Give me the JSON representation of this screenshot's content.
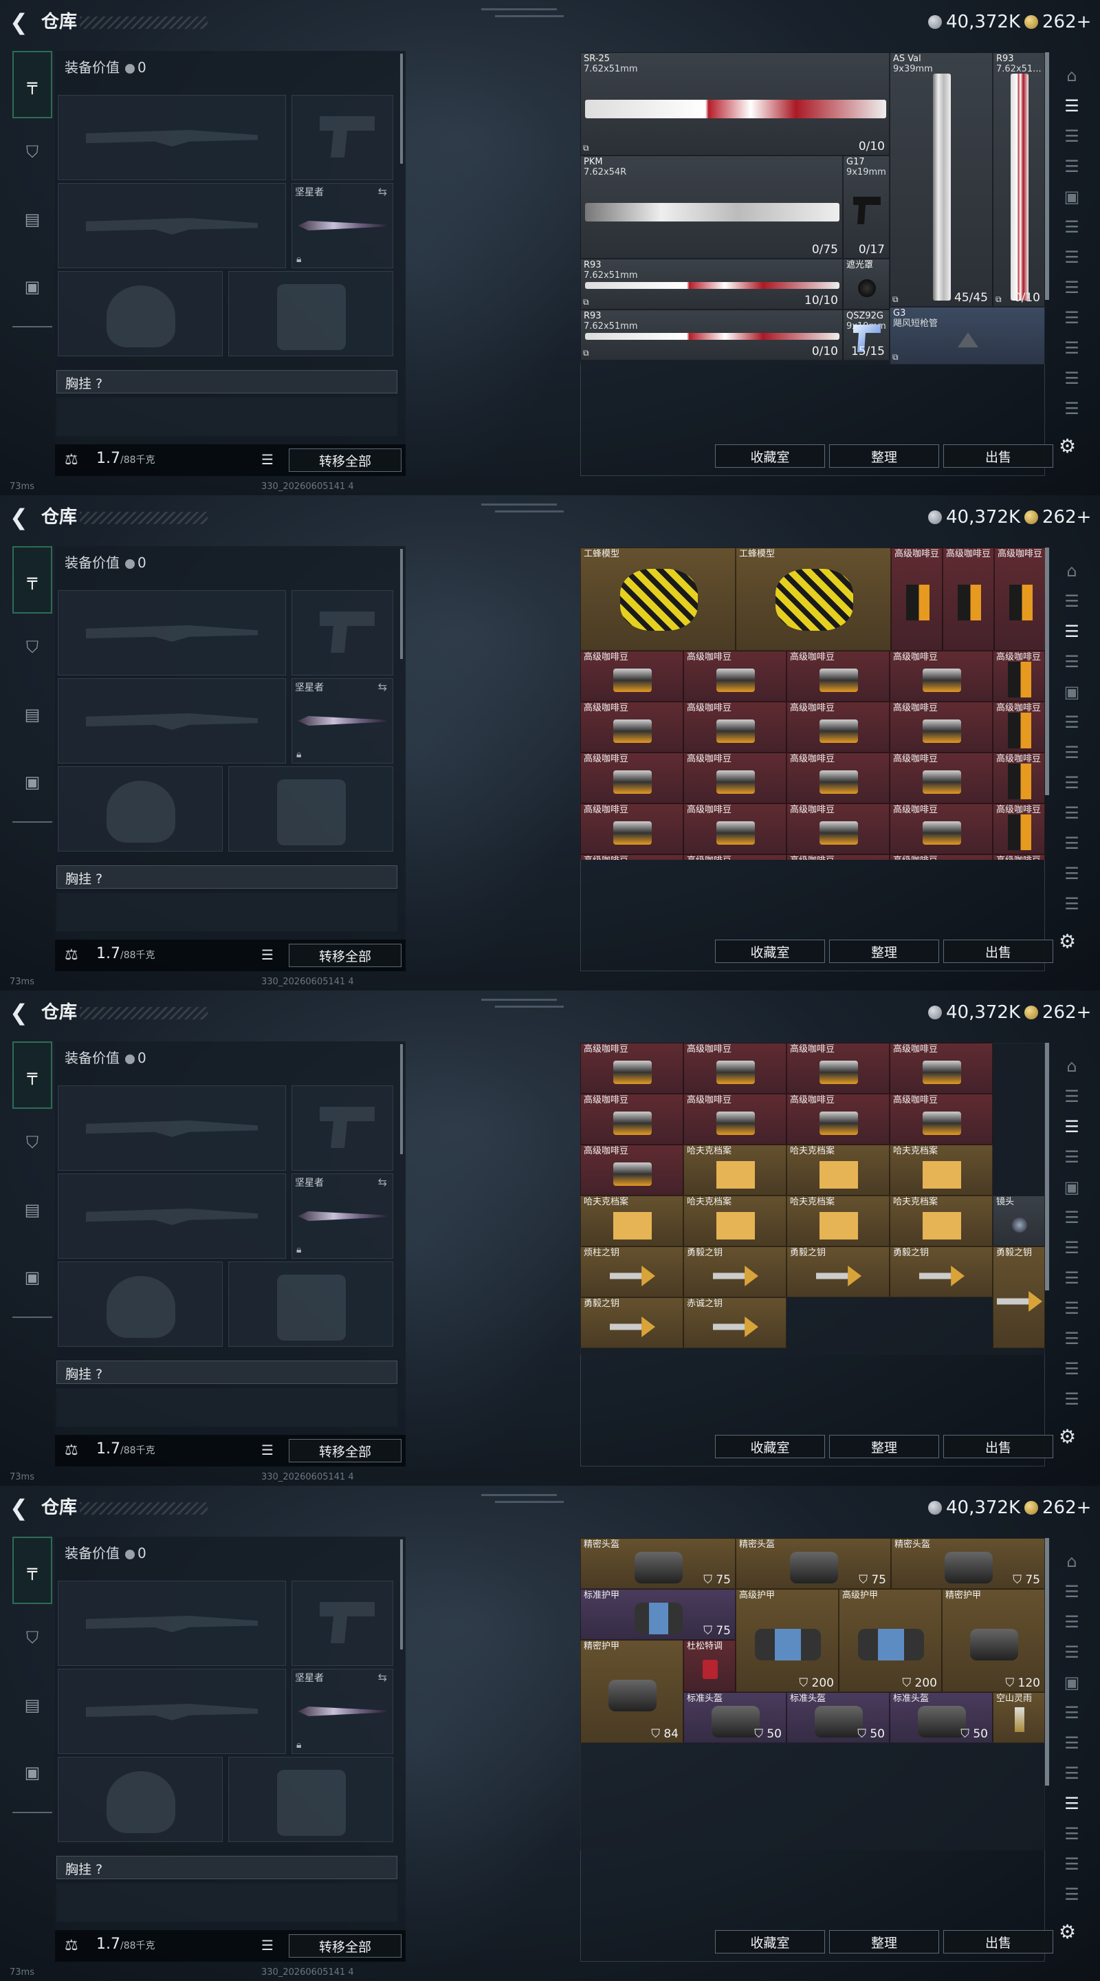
{
  "header": {
    "title": "仓库",
    "silver": "40,372K",
    "gold": "262+"
  },
  "loadout": {
    "value_label": "装备价值",
    "value": "0",
    "knife_label": "坚星者",
    "vest_label": "胸挂 ?",
    "weight": "1.7",
    "weight_max": "/88千克",
    "transfer_all": "转移全部"
  },
  "actions": {
    "collection": "收藏室",
    "sort": "整理",
    "sell": "出售"
  },
  "status": {
    "ping": "73ms",
    "build": "330_20260605141 4"
  },
  "icons": {
    "back": "back-arrow-icon",
    "coin": "coin-icon",
    "gold": "gold-coin-icon",
    "lock": "lock-icon",
    "gear": "gear-icon"
  },
  "screens": [
    {
      "cells": [
        {
          "name": "SR-25",
          "sub": "7.62x51mm",
          "count": "0/10",
          "bound": true,
          "tone": "gray",
          "art": "rifle-white-red"
        },
        {
          "name": "AS Val",
          "sub": "9x39mm",
          "count": "45/45",
          "bound": true,
          "tone": "gray",
          "art": "rifle-vertical"
        },
        {
          "name": "R93",
          "sub": "7.62x51...",
          "count": "0/10",
          "bound": true,
          "tone": "gray",
          "art": "rifle-vertical-red"
        },
        {
          "name": "PKM",
          "sub": "7.62x54R",
          "count": "0/75",
          "bound": false,
          "tone": "gray",
          "art": "mg-white"
        },
        {
          "name": "G17",
          "sub": "9x19mm",
          "count": "0/17",
          "bound": false,
          "tone": "gray",
          "art": "pistol"
        },
        {
          "name": "R93",
          "sub": "7.62x51mm",
          "count": "10/10",
          "bound": true,
          "tone": "gray",
          "art": "sniper-red"
        },
        {
          "name": "遮光罩",
          "sub": "",
          "count": "",
          "bound": false,
          "tone": "gray",
          "art": "shade"
        },
        {
          "name": "R93",
          "sub": "7.62x51mm",
          "count": "0/10",
          "bound": true,
          "tone": "gray",
          "art": "sniper-red"
        },
        {
          "name": "QSZ92G",
          "sub": "9x19mm",
          "count": "15/15",
          "bound": false,
          "tone": "gray",
          "art": "pistol-blue"
        },
        {
          "name": "G3",
          "sub": "飓风短枪管",
          "count": "",
          "bound": true,
          "tone": "blue",
          "art": "barrel"
        }
      ]
    },
    {
      "cells": [
        {
          "name": "工蜂模型",
          "tone": "gold",
          "art": "bee"
        },
        {
          "name": "工蜂模型",
          "tone": "gold",
          "art": "bee"
        },
        {
          "name": "高级咖啡豆",
          "tone": "red",
          "art": "coffee-bag"
        },
        {
          "name": "高级咖啡豆",
          "tone": "red",
          "art": "coffee-bag"
        },
        {
          "name": "高级咖啡豆",
          "tone": "red",
          "art": "coffee-bag"
        },
        {
          "name": "高级咖啡豆",
          "tone": "red",
          "art": "coffee-box"
        },
        {
          "name": "哈夫克档案",
          "tone": "gold",
          "art": "file"
        }
      ]
    },
    {
      "cells": [
        {
          "name": "高级咖啡豆",
          "tone": "red",
          "art": "coffee-box"
        },
        {
          "name": "哈夫克档案",
          "tone": "gold",
          "art": "file"
        },
        {
          "name": "镜头",
          "tone": "gray",
          "art": "lens"
        },
        {
          "name": "烦柱之钥",
          "tone": "gold",
          "art": "key"
        },
        {
          "name": "勇毅之钥",
          "tone": "gold",
          "art": "key"
        },
        {
          "name": "赤诚之钥",
          "tone": "gold",
          "art": "key"
        }
      ]
    },
    {
      "cells": [
        {
          "name": "精密头盔",
          "count": "75",
          "tone": "gold",
          "art": "bag"
        },
        {
          "name": "标准护甲",
          "count": "75",
          "tone": "purple",
          "art": "vest-blue"
        },
        {
          "name": "高级护甲",
          "count": "200",
          "tone": "gold",
          "art": "vest-big"
        },
        {
          "name": "精密护甲",
          "count": "120",
          "tone": "gold",
          "art": "vest"
        },
        {
          "name": "精密护甲",
          "count": "84",
          "tone": "gold",
          "art": "vest"
        },
        {
          "name": "杜松特调",
          "count": "",
          "tone": "red",
          "art": "drink"
        },
        {
          "name": "标准头盔",
          "count": "50",
          "tone": "purple",
          "art": "helmet"
        },
        {
          "name": "空山灵雨",
          "count": "",
          "tone": "gold",
          "art": "incense"
        }
      ]
    }
  ]
}
